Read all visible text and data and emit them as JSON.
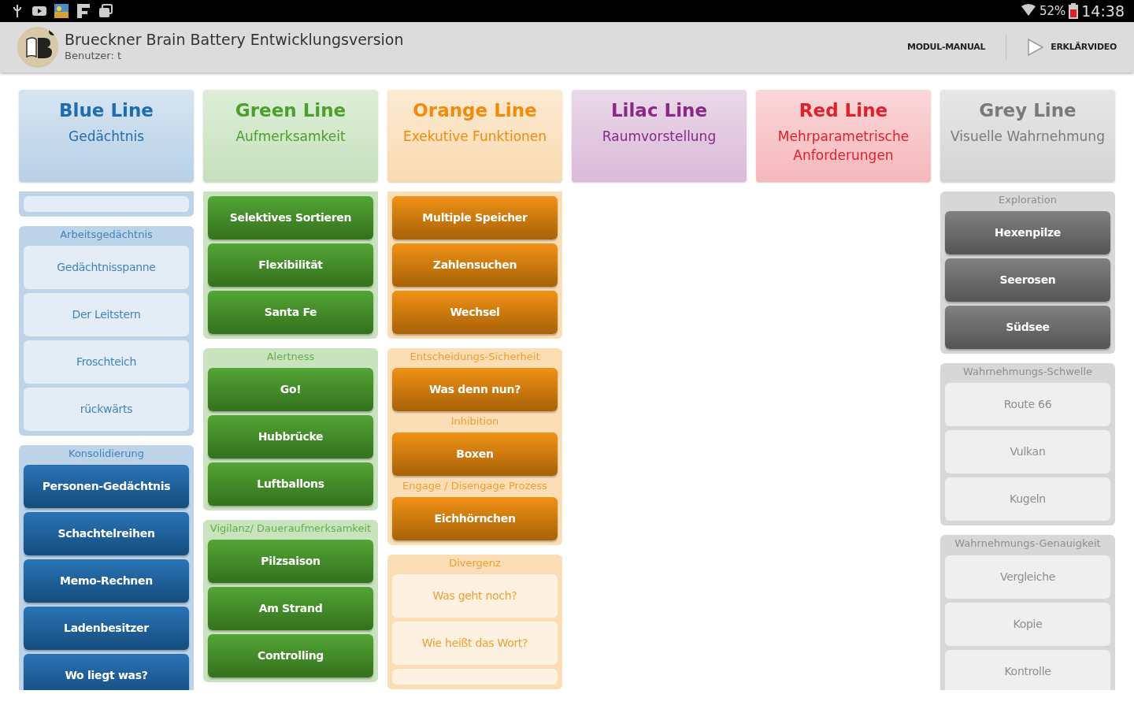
{
  "status_bar": {
    "battery": "52%",
    "time": "14:38"
  },
  "app_bar": {
    "title": "Brueckner Brain Battery Entwicklungsversion",
    "subtitle": "Benutzer: t",
    "actions": [
      {
        "kind": "text",
        "label": "MODUL-MANUAL"
      },
      {
        "kind": "video",
        "label": "ERKLÄRVIDEO"
      }
    ]
  },
  "lines": [
    {
      "color": "#1e6db3",
      "title": "Blue Line",
      "subtitle": "Gedächtnis",
      "groups": [
        {
          "kind": "cut-top",
          "items": [
            {
              "kind": "cut"
            }
          ]
        },
        {
          "kind": "full",
          "title": "Arbeitsgedächtnis",
          "items": [
            {
              "kind": "game",
              "label": "Gedächtnisspanne",
              "enabled": false
            },
            {
              "kind": "game",
              "label": "Der Leitstern",
              "enabled": false
            },
            {
              "kind": "game",
              "label": "Froschteich",
              "enabled": false
            },
            {
              "kind": "game",
              "label": "rückwärts",
              "enabled": false
            }
          ]
        },
        {
          "kind": "full",
          "title": "Konsolidierung",
          "items": [
            {
              "kind": "game",
              "label": "Personen-Gedächtnis",
              "enabled": true
            },
            {
              "kind": "game",
              "label": "Schachtelreihen",
              "enabled": true
            },
            {
              "kind": "game",
              "label": "Memo-Rechnen",
              "enabled": true
            },
            {
              "kind": "game",
              "label": "Ladenbesitzer",
              "enabled": true
            },
            {
              "kind": "game",
              "label": "Wo liegt was?",
              "enabled": true
            }
          ]
        }
      ]
    },
    {
      "color": "#4aa12a",
      "title": "Green Line",
      "subtitle": "Aufmerksamkeit",
      "groups": [
        {
          "kind": "cut-top",
          "items": [
            {
              "kind": "game",
              "label": "Selektives Sortieren",
              "enabled": true
            },
            {
              "kind": "game",
              "label": "Flexibilität",
              "enabled": true
            },
            {
              "kind": "game",
              "label": "Santa Fe",
              "enabled": true
            }
          ]
        },
        {
          "kind": "full",
          "title": "Alertness",
          "items": [
            {
              "kind": "game",
              "label": "Go!",
              "enabled": true
            },
            {
              "kind": "game",
              "label": "Hubbrücke",
              "enabled": true
            },
            {
              "kind": "game",
              "label": "Luftballons",
              "enabled": true
            }
          ]
        },
        {
          "kind": "full",
          "title": "Vigilanz/ Daueraufmerksamkeit",
          "items": [
            {
              "kind": "game",
              "label": "Pilzsaison",
              "enabled": true
            },
            {
              "kind": "game",
              "label": "Am Strand",
              "enabled": true
            },
            {
              "kind": "game",
              "label": "Controlling",
              "enabled": true
            }
          ]
        }
      ]
    },
    {
      "color": "#f08c0a",
      "title": "Orange Line",
      "subtitle": "Exekutive Funktionen",
      "groups": [
        {
          "kind": "cut-top",
          "items": [
            {
              "kind": "game",
              "label": "Multiple Speicher",
              "enabled": true
            },
            {
              "kind": "game",
              "label": "Zahlensuchen",
              "enabled": true
            },
            {
              "kind": "game",
              "label": "Wechsel",
              "enabled": true
            }
          ]
        },
        {
          "kind": "full",
          "title": "Entscheidungs-Sicherheit",
          "items": [
            {
              "kind": "game",
              "label": "Was denn nun?",
              "enabled": true
            },
            {
              "kind": "heading",
              "label": "Inhibition"
            },
            {
              "kind": "game",
              "label": "Boxen",
              "enabled": true
            },
            {
              "kind": "heading",
              "label": "Engage / Disengage Prozess"
            },
            {
              "kind": "game",
              "label": "Eichhörnchen",
              "enabled": true
            }
          ]
        },
        {
          "kind": "full",
          "title": "Divergenz",
          "items": [
            {
              "kind": "game",
              "label": "Was geht noch?",
              "enabled": false
            },
            {
              "kind": "game",
              "label": "Wie heißt das Wort?",
              "enabled": false
            },
            {
              "kind": "cut"
            }
          ]
        }
      ]
    },
    {
      "color": "#8a2886",
      "title": "Lilac Line",
      "subtitle": "Raumvorstellung"
    },
    {
      "color": "#e1202c",
      "title": "Red Line",
      "subtitle": "Mehrparametrische Anforderungen"
    },
    {
      "color": "#7a7a7a",
      "title": "Grey Line",
      "subtitle": "Visuelle Wahrnehmung",
      "groups": [
        {
          "kind": "full",
          "title": "Exploration",
          "items": [
            {
              "kind": "game",
              "label": "Hexenpilze",
              "enabled": true
            },
            {
              "kind": "game",
              "label": "Seerosen",
              "enabled": true
            },
            {
              "kind": "game",
              "label": "Südsee",
              "enabled": true
            }
          ]
        },
        {
          "kind": "full",
          "title": "Wahrnehmungs-Schwelle",
          "items": [
            {
              "kind": "game",
              "label": "Route 66",
              "enabled": false
            },
            {
              "kind": "game",
              "label": "Vulkan",
              "enabled": false
            },
            {
              "kind": "game",
              "label": "Kugeln",
              "enabled": false
            }
          ]
        },
        {
          "kind": "full",
          "title": "Wahrnehmungs-Genauigkeit",
          "items": [
            {
              "kind": "game",
              "label": "Vergleiche",
              "enabled": false
            },
            {
              "kind": "game",
              "label": "Kopie",
              "enabled": false
            },
            {
              "kind": "game",
              "label": "Kontrolle",
              "enabled": false
            }
          ]
        }
      ]
    }
  ]
}
